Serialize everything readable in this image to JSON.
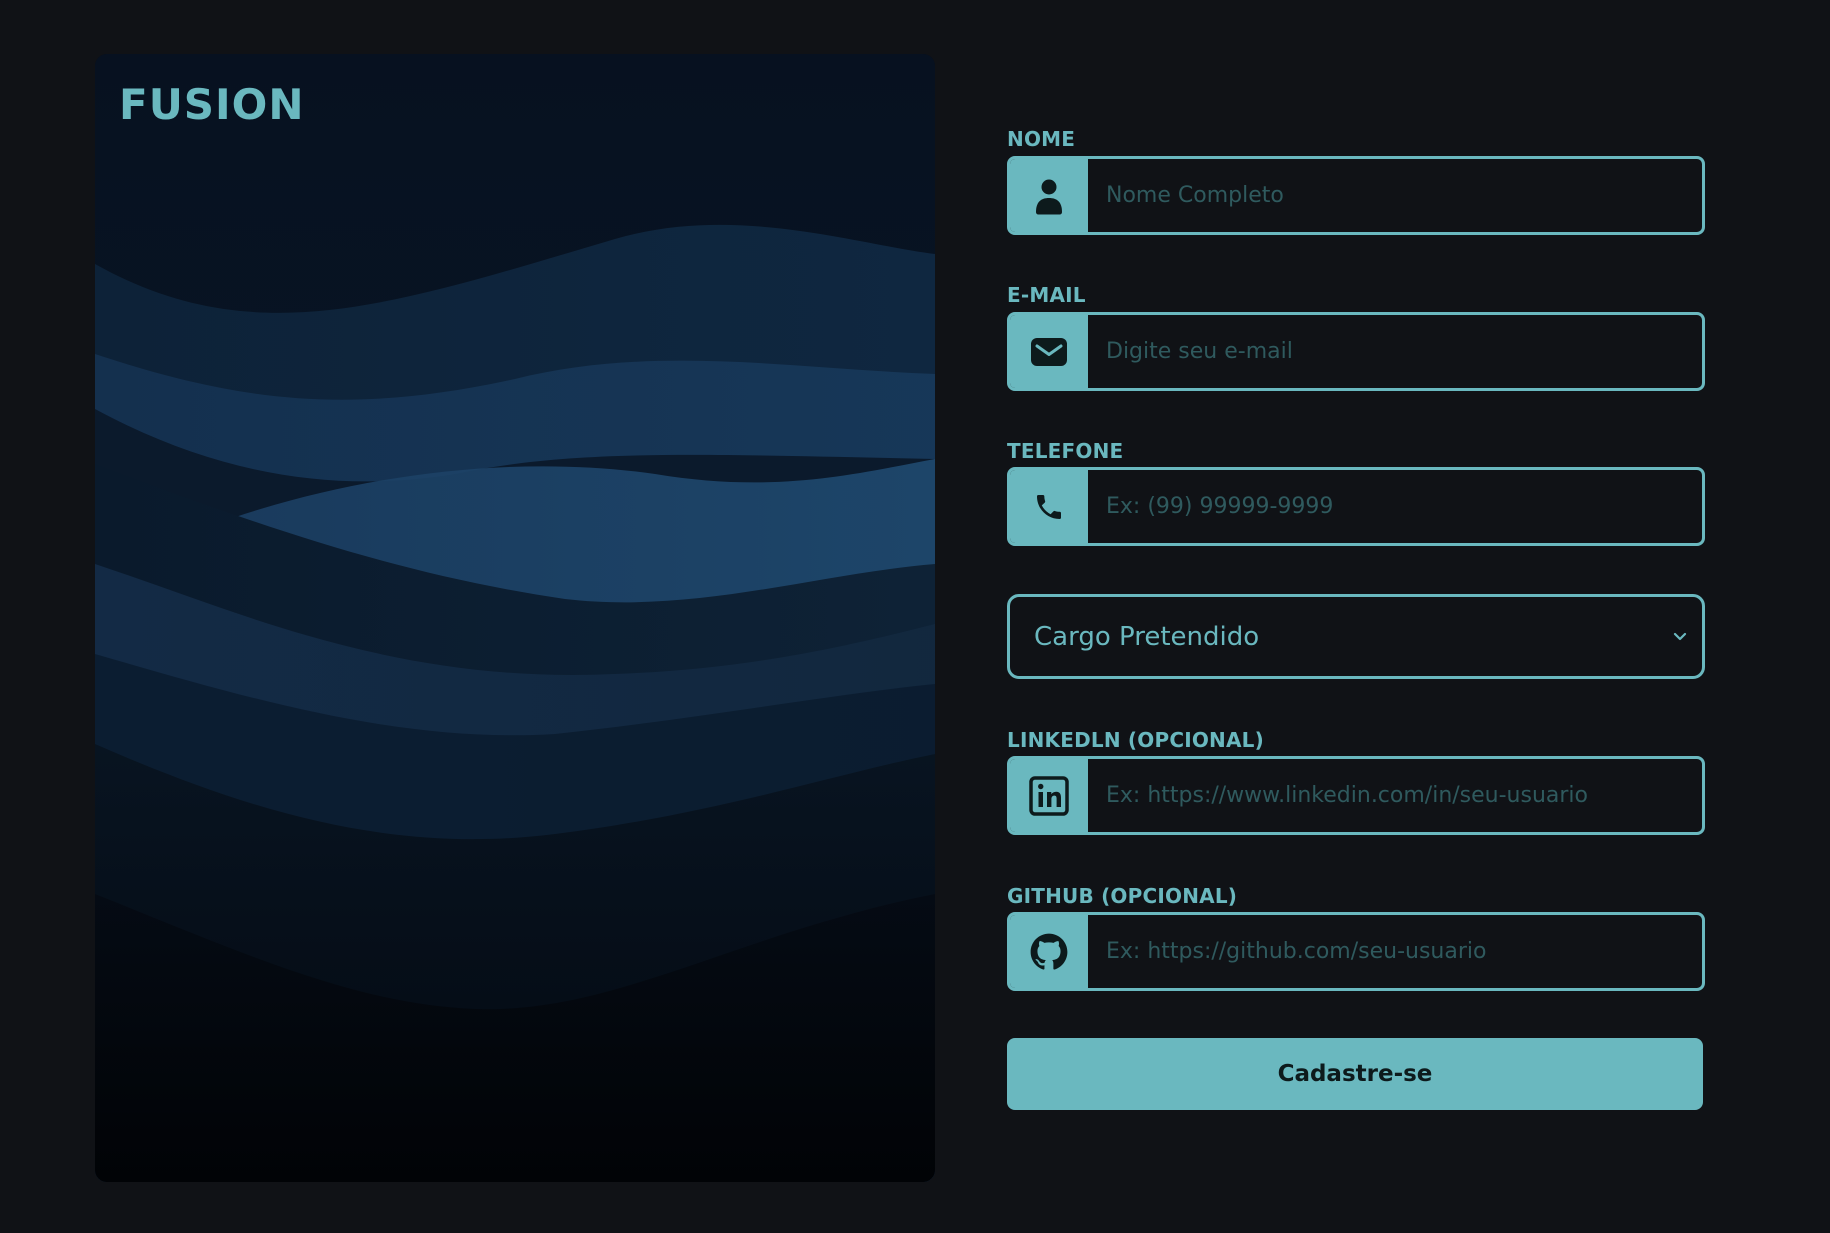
{
  "brand": "FUSION",
  "colors": {
    "accent": "#6ab8bf",
    "background": "#101216",
    "panel": "#050b14"
  },
  "form": {
    "fields": [
      {
        "label": "NOME",
        "placeholder": "Nome Completo",
        "icon": "user-icon"
      },
      {
        "label": "E-MAIL",
        "placeholder": "Digite seu e-mail",
        "icon": "envelope-icon"
      },
      {
        "label": "TELEFONE",
        "placeholder": "Ex: (99) 99999-9999",
        "icon": "phone-icon"
      },
      {
        "label": "LINKEDLN (OPCIONAL)",
        "placeholder": "Ex: https://www.linkedin.com/in/seu-usuario",
        "icon": "linkedin-icon"
      },
      {
        "label": "GITHUB (OPCIONAL)",
        "placeholder": "Ex: https://github.com/seu-usuario",
        "icon": "github-icon"
      }
    ],
    "cargo_select": {
      "selected": "Cargo Pretendido",
      "icon": "chevron-down-icon"
    },
    "submit_label": "Cadastre-se"
  }
}
